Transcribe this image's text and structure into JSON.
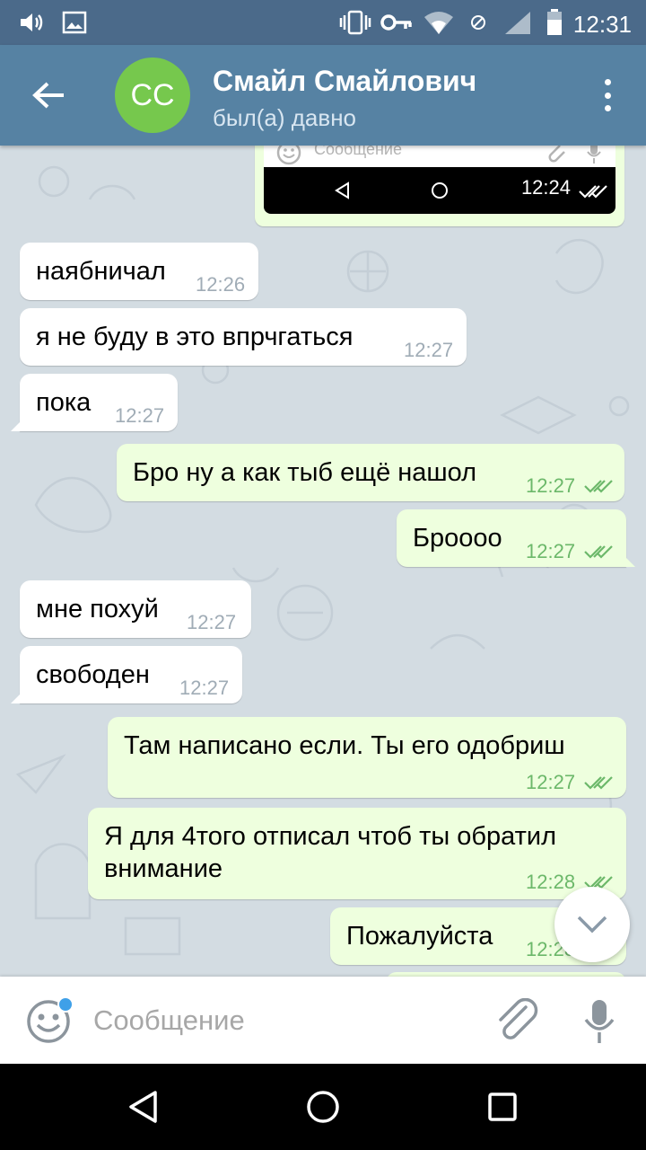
{
  "status_bar": {
    "time": "12:31",
    "icons": [
      "volume-icon",
      "image-icon",
      "vibrate-icon",
      "key-icon",
      "wifi-icon",
      "no-sim-icon",
      "signal-icon",
      "battery-icon"
    ]
  },
  "header": {
    "contact_name": "Смайл Смайлович",
    "contact_status": "был(а) давно",
    "avatar_initials": "CC",
    "avatar_color": "#76c84d",
    "bar_color": "#5682a3"
  },
  "image_message": {
    "inner_placeholder": "Сообщение",
    "time": "12:24"
  },
  "messages": [
    {
      "direction": "in",
      "text": "наябничал",
      "time": "12:26"
    },
    {
      "direction": "in",
      "text": "я не буду в это впрчгаться",
      "time": "12:27"
    },
    {
      "direction": "in",
      "text": "пока",
      "time": "12:27"
    },
    {
      "direction": "out",
      "text": "Бро ну а как тыб ещё нашол",
      "time": "12:27"
    },
    {
      "direction": "out",
      "text": "Броооо",
      "time": "12:27"
    },
    {
      "direction": "in",
      "text": "мне похуй",
      "time": "12:27"
    },
    {
      "direction": "in",
      "text": "свободен",
      "time": "12:27"
    },
    {
      "direction": "out",
      "text": "Там написано если. Ты его одобриш",
      "time": "12:27"
    },
    {
      "direction": "out",
      "text_line1": "Я для 4того отписал чтоб ты обратил",
      "text_line2": "внимание",
      "time": "12:28"
    },
    {
      "direction": "out",
      "text": "Пожалуйста",
      "time": "12:28"
    }
  ],
  "input": {
    "placeholder": "Сообщение"
  },
  "colors": {
    "chat_background": "#d3dce2",
    "incoming_bubble": "#ffffff",
    "outgoing_bubble": "#eeffde",
    "check_color": "#6cb86a"
  }
}
